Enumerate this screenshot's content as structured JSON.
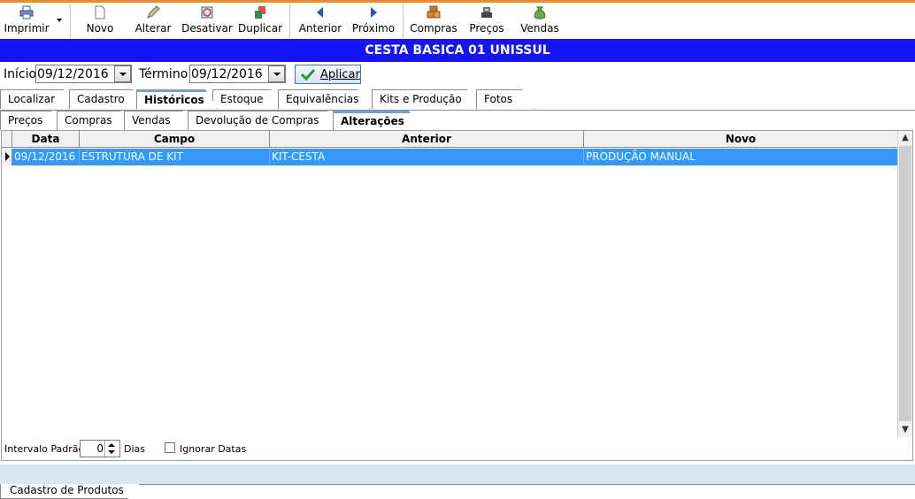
{
  "toolbar": {
    "buttons": [
      {
        "label": "Imprimir",
        "icon": "printer-icon"
      },
      {
        "label": "Novo",
        "icon": "new-document-icon"
      },
      {
        "label": "Alterar",
        "icon": "pencil-icon"
      },
      {
        "label": "Desativar",
        "icon": "deactivate-icon"
      },
      {
        "label": "Duplicar",
        "icon": "duplicate-icon"
      },
      {
        "label": "Anterior",
        "icon": "arrow-left-icon"
      },
      {
        "label": "Próximo",
        "icon": "arrow-right-icon"
      },
      {
        "label": "Compras",
        "icon": "boxes-icon"
      },
      {
        "label": "Preços",
        "icon": "cash-register-icon"
      },
      {
        "label": "Vendas",
        "icon": "money-bag-icon"
      }
    ]
  },
  "title": "CESTA BASICA 01 UNISSUL",
  "filter": {
    "inicio_label": "Início",
    "inicio_value": "09/12/2016",
    "termino_label": "Término",
    "termino_value": "09/12/2016",
    "apply_label": "Aplicar"
  },
  "tabs_main": [
    "Localizar",
    "Cadastro",
    "Históricos",
    "Estoque",
    "Equivalências",
    "Kits e Produção",
    "Fotos"
  ],
  "tabs_main_active": "Históricos",
  "tabs_sub": [
    "Preços",
    "Compras",
    "Vendas",
    "Devolução de Compras",
    "Alterações"
  ],
  "tabs_sub_active": "Alterações",
  "grid": {
    "columns": [
      "Data",
      "Campo",
      "Anterior",
      "Novo"
    ],
    "rows": [
      {
        "data": "09/12/2016",
        "campo": "ESTRUTURA DE KIT",
        "anterior": "KIT-CESTA",
        "novo": "PRODUÇÃO MANUAL"
      }
    ]
  },
  "footer": {
    "intervalo_label": "Intervalo Padrão",
    "intervalo_value": "0",
    "dias_label": "Dias",
    "ignorar_label": "Ignorar Datas"
  },
  "bottom_tab": "Cadastro de Produtos",
  "colors": {
    "accent_orange": "#f08a24",
    "title_blue": "#1414f5",
    "selection": "#3399ff"
  }
}
